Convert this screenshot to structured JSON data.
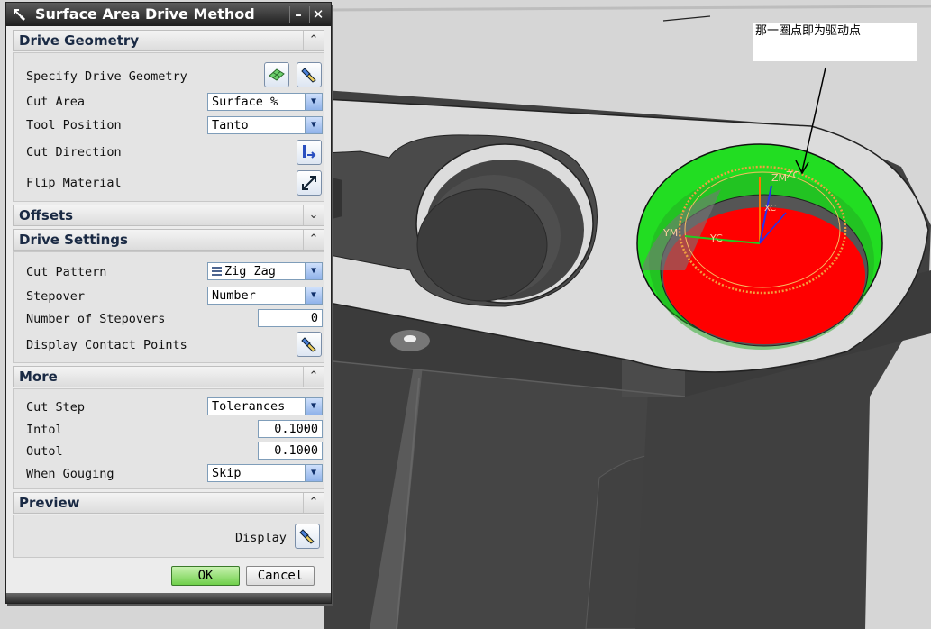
{
  "annotation": {
    "text": "那一圈点即为驱动点"
  },
  "viewport_axes": {
    "zm": "ZM",
    "zc": "ZC",
    "xc": "XC",
    "ym": "YM",
    "yc": "YC"
  },
  "dialog": {
    "title": "Surface Area Drive Method",
    "minimize_label": "–",
    "close_label": "✕",
    "sections": {
      "drive_geometry": {
        "title": "Drive Geometry",
        "state": "expanded",
        "specify_label": "Specify Drive Geometry",
        "cut_area_label": "Cut Area",
        "cut_area_value": "Surface %",
        "tool_position_label": "Tool Position",
        "tool_position_value": "Tanto",
        "cut_direction_label": "Cut Direction",
        "flip_material_label": "Flip Material"
      },
      "offsets": {
        "title": "Offsets",
        "state": "collapsed"
      },
      "drive_settings": {
        "title": "Drive Settings",
        "state": "expanded",
        "cut_pattern_label": "Cut Pattern",
        "cut_pattern_value": "Zig Zag",
        "stepover_label": "Stepover",
        "stepover_value": "Number",
        "num_stepovers_label": "Number of Stepovers",
        "num_stepovers_value": "0",
        "contact_points_label": "Display Contact Points"
      },
      "more": {
        "title": "More",
        "state": "expanded",
        "cut_step_label": "Cut Step",
        "cut_step_value": "Tolerances",
        "intol_label": "Intol",
        "intol_value": "0.1000",
        "outol_label": "Outol",
        "outol_value": "0.1000",
        "gouging_label": "When Gouging",
        "gouging_value": "Skip"
      },
      "preview": {
        "title": "Preview",
        "state": "expanded",
        "display_label": "Display"
      }
    },
    "ok_label": "OK",
    "cancel_label": "Cancel"
  },
  "colors": {
    "bore_face": "#ff0000",
    "bore_wall": "#22dd22",
    "drive_points": "#f0a040",
    "part": "#454545",
    "part_top": "#dcdcdc"
  }
}
